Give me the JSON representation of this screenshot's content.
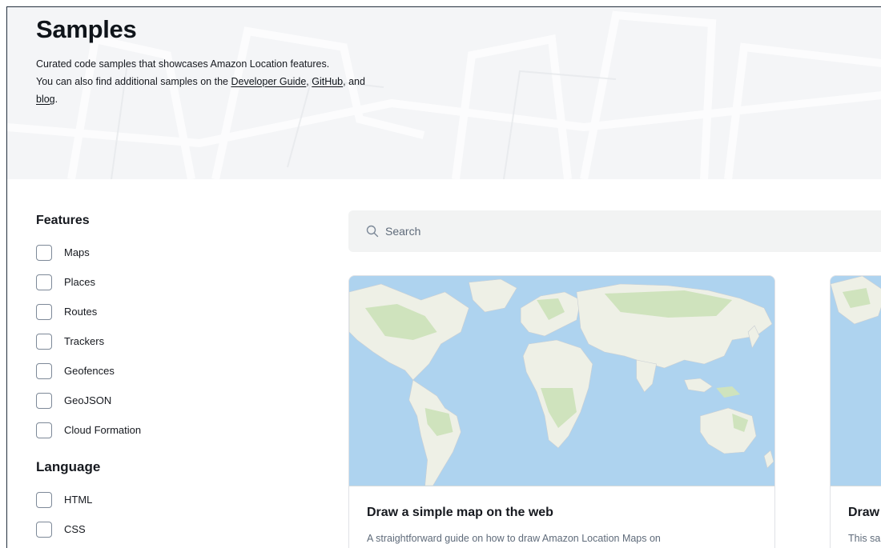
{
  "header": {
    "title": "Samples",
    "intro_line1": "Curated code samples that showcases Amazon Location features.",
    "intro_line2_prefix": "You can also find additional samples on the ",
    "link_developer_guide": "Developer Guide",
    "sep1": ", ",
    "link_github": "GitHub",
    "sep2": ", and ",
    "link_blog": "blog",
    "suffix": "."
  },
  "filters": {
    "features_title": "Features",
    "features": [
      "Maps",
      "Places",
      "Routes",
      "Trackers",
      "Geofences",
      "GeoJSON",
      "Cloud Formation"
    ],
    "language_title": "Language",
    "languages": [
      "HTML",
      "CSS"
    ]
  },
  "search": {
    "placeholder": "Search",
    "icon": "search-icon"
  },
  "cards": [
    {
      "title": "Draw a simple map on the web",
      "description": "A straightforward guide on how to draw Amazon Location Maps on"
    },
    {
      "title": "Draw",
      "description": "This sa"
    }
  ],
  "colors": {
    "ocean": "#aed3ef",
    "land": "#eef0e6",
    "vegetation": "#cfe3bd",
    "text": "#16191f",
    "muted": "#5f6b7a"
  }
}
